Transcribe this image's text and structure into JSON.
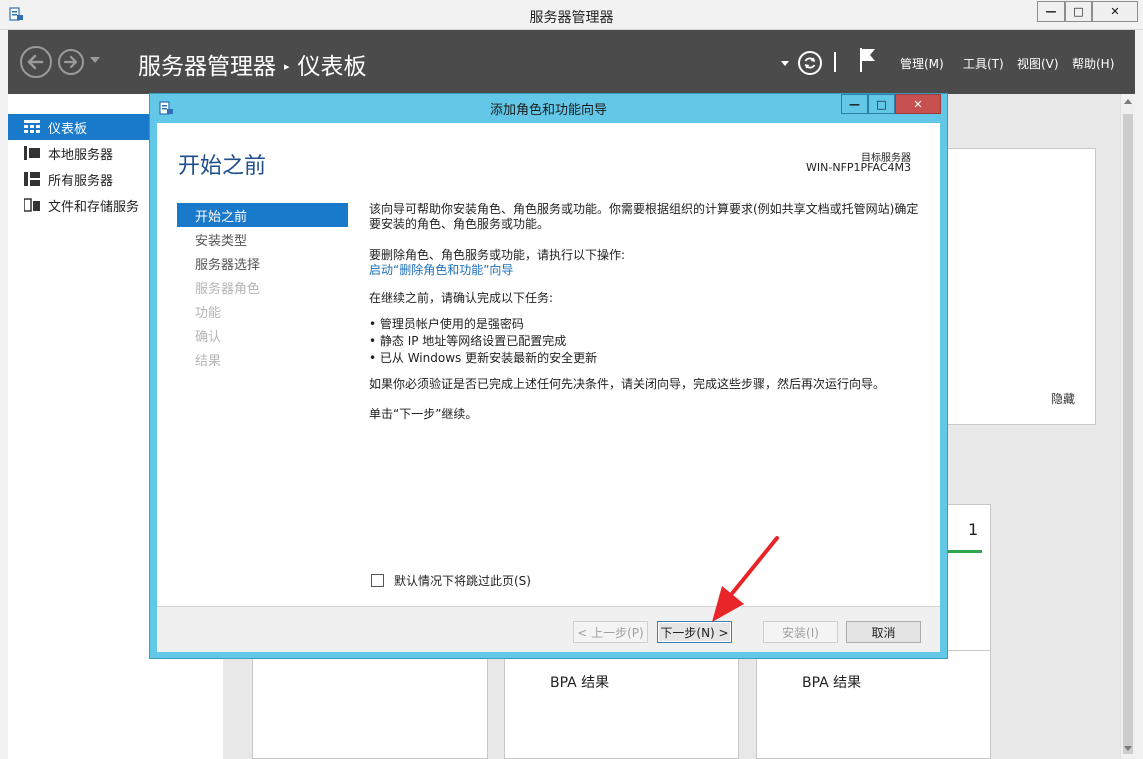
{
  "window": {
    "title": "服务器管理器",
    "controls": {
      "minimize": "—",
      "maximize": "□",
      "close": "✕"
    }
  },
  "header": {
    "breadcrumb_root": "服务器管理器",
    "breadcrumb_sep": "▸",
    "breadcrumb_page": "仪表板",
    "menus": {
      "manage": "管理(M)",
      "tools": "工具(T)",
      "view": "视图(V)",
      "help": "帮助(H)"
    }
  },
  "sidebar": {
    "items": [
      {
        "label": "仪表板",
        "icon": "dashboard-icon",
        "active": true
      },
      {
        "label": "本地服务器",
        "icon": "local-server-icon",
        "active": false
      },
      {
        "label": "所有服务器",
        "icon": "all-servers-icon",
        "active": false
      },
      {
        "label": "文件和存储服务",
        "icon": "file-storage-icon",
        "active": false
      }
    ]
  },
  "background": {
    "hide_label": "隐藏",
    "tile_count": "1",
    "bpa_label_1": "BPA 结果",
    "bpa_label_2": "BPA 结果"
  },
  "wizard": {
    "title": "添加角色和功能向导",
    "controls": {
      "minimize": "—",
      "maximize": "□",
      "close": "✕"
    },
    "heading": "开始之前",
    "target_label": "目标服务器",
    "target_value": "WIN-NFP1PFAC4M3",
    "steps": [
      {
        "label": "开始之前",
        "state": "active"
      },
      {
        "label": "安装类型",
        "state": "enabled"
      },
      {
        "label": "服务器选择",
        "state": "enabled"
      },
      {
        "label": "服务器角色",
        "state": "disabled"
      },
      {
        "label": "功能",
        "state": "disabled"
      },
      {
        "label": "确认",
        "state": "disabled"
      },
      {
        "label": "结果",
        "state": "disabled"
      }
    ],
    "content": {
      "intro_line1": "该向导可帮助你安装角色、角色服务或功能。你需要根据组织的计算要求(例如共享文档或托管网站)确定",
      "intro_line2": "要安装的角色、角色服务或功能。",
      "remove_text": "要删除角色、角色服务或功能，请执行以下操作:",
      "remove_link": "启动“删除角色和功能”向导",
      "before_continue": "在继续之前，请确认完成以下任务:",
      "bullets": [
        "• 管理员帐户使用的是强密码",
        "• 静态 IP 地址等网络设置已配置完成",
        "• 已从 Windows 更新安装最新的安全更新"
      ],
      "verify_text": "如果你必须验证是否已完成上述任何先决条件，请关闭向导，完成这些步骤，然后再次运行向导。",
      "click_next": "单击“下一步”继续。"
    },
    "skip_label": "默认情况下将跳过此页(S)",
    "skip_checked": false,
    "buttons": {
      "prev": "< 上一步(P)",
      "next": "下一步(N) >",
      "install": "安装(I)",
      "cancel": "取消"
    }
  },
  "colors": {
    "accent": "#1979ca",
    "wizard_frame": "#63c8e8",
    "header_bg": "#4b4b4b",
    "annotation": "#e8262a"
  }
}
